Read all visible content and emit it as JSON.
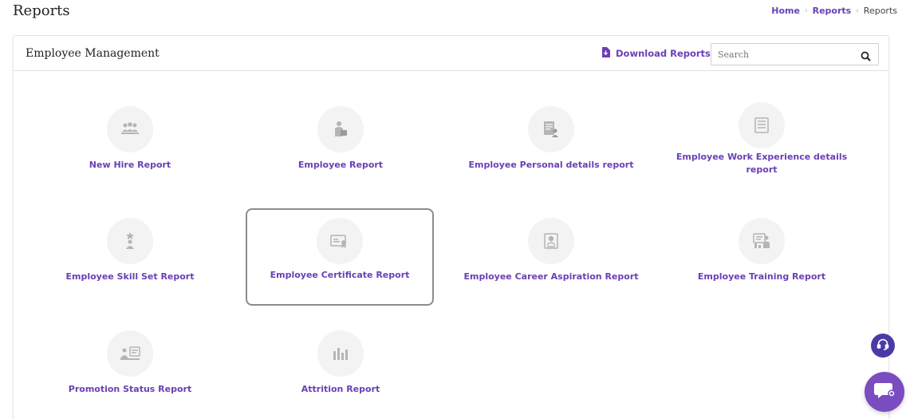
{
  "page": {
    "title": "Reports"
  },
  "breadcrumb": {
    "items": [
      "Home",
      "Reports"
    ],
    "current": "Reports"
  },
  "card": {
    "title": "Employee Management",
    "download_label": "Download Reports",
    "search_placeholder": "Search",
    "search_value": ""
  },
  "reports": [
    {
      "label": "New Hire Report",
      "icon": "new-hire-icon"
    },
    {
      "label": "Employee Report",
      "icon": "employee-icon"
    },
    {
      "label": "Employee Personal details report",
      "icon": "personal-details-icon"
    },
    {
      "label": "Employee Work Experience details report",
      "icon": "work-experience-icon"
    },
    {
      "label": "Employee Skill Set Report",
      "icon": "skill-set-icon"
    },
    {
      "label": "Employee Certificate Report",
      "icon": "certificate-icon",
      "selected": true
    },
    {
      "label": "Employee Career Aspiration Report",
      "icon": "career-aspiration-icon"
    },
    {
      "label": "Employee Training Report",
      "icon": "training-icon"
    },
    {
      "label": "Promotion Status Report",
      "icon": "promotion-icon"
    },
    {
      "label": "Attrition Report",
      "icon": "attrition-chart-icon"
    }
  ],
  "colors": {
    "accent": "#6a3fb5",
    "chat_button": "#7b4cc0",
    "support_button": "#4a3aa8",
    "icon_circle": "#f3f3f3",
    "icon_glyph": "#b5b5b5"
  },
  "floating": {
    "support_icon": "headset-icon",
    "chat_icon": "chat-icon"
  }
}
